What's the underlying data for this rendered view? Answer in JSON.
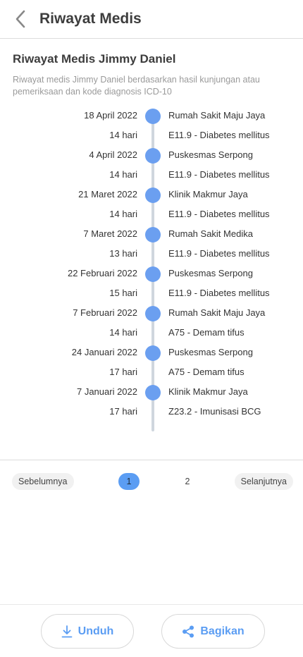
{
  "header": {
    "title": "Riwayat Medis",
    "back_icon": "chevron-left-icon"
  },
  "section": {
    "title": "Riwayat Medis Jimmy Daniel",
    "description": "Riwayat medis Jimmy Daniel berdasarkan hasil kunjungan atau pemeriksaan dan kode diagnosis ICD-10"
  },
  "entries": [
    {
      "date": "18 April 2022",
      "place": "Rumah Sakit Maju Jaya",
      "duration": "14 hari",
      "diagnosis": "E11.9 - Diabetes mellitus"
    },
    {
      "date": "4 April 2022",
      "place": "Puskesmas Serpong",
      "duration": "14 hari",
      "diagnosis": "E11.9 - Diabetes mellitus"
    },
    {
      "date": "21 Maret 2022",
      "place": "Klinik Makmur Jaya",
      "duration": "14 hari",
      "diagnosis": "E11.9 - Diabetes mellitus"
    },
    {
      "date": "7 Maret 2022",
      "place": "Rumah Sakit Medika",
      "duration": "13 hari",
      "diagnosis": "E11.9 - Diabetes mellitus"
    },
    {
      "date": "22 Februari 2022",
      "place": "Puskesmas Serpong",
      "duration": "15 hari",
      "diagnosis": "E11.9 - Diabetes mellitus"
    },
    {
      "date": "7 Februari 2022",
      "place": "Rumah Sakit Maju Jaya",
      "duration": "14 hari",
      "diagnosis": "A75 - Demam tifus"
    },
    {
      "date": "24 Januari 2022",
      "place": "Puskesmas Serpong",
      "duration": "17 hari",
      "diagnosis": "A75 - Demam tifus"
    },
    {
      "date": "7 Januari 2022",
      "place": "Klinik Makmur Jaya",
      "duration": "17 hari",
      "diagnosis": "Z23.2 - Imunisasi BCG"
    }
  ],
  "pagination": {
    "prev_label": "Sebelumnya",
    "next_label": "Selanjutnya",
    "pages": [
      "1",
      "2"
    ],
    "current_page": "1"
  },
  "footer": {
    "download_label": "Unduh",
    "download_icon": "download-icon",
    "share_label": "Bagikan",
    "share_icon": "share-icon"
  },
  "colors": {
    "accent": "#5b9df3",
    "timeline_dot": "#6b9ff0",
    "timeline_line": "#cfd6de",
    "muted_text": "#9a9a9a"
  }
}
